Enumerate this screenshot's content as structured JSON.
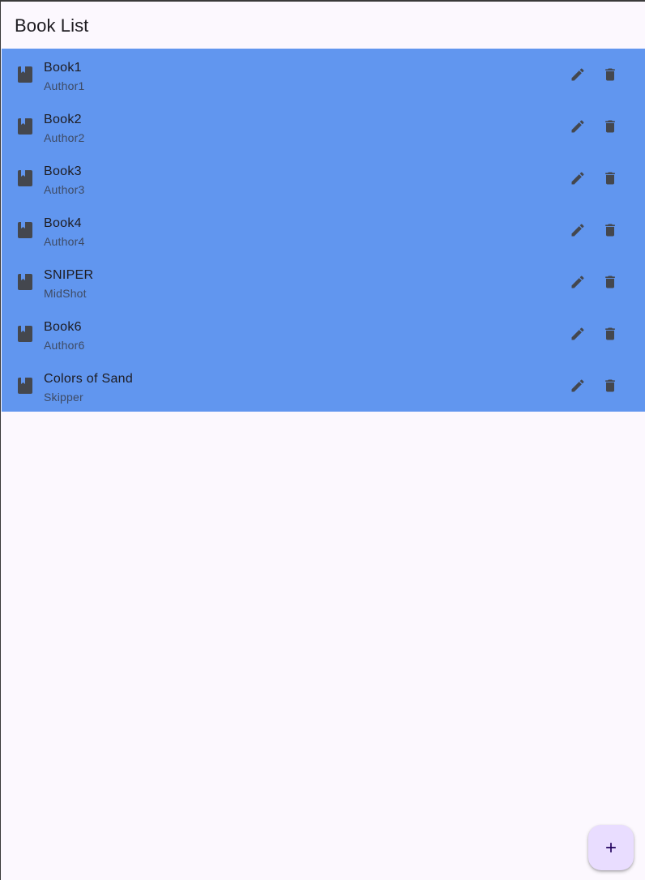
{
  "appbar": {
    "title": "Book List"
  },
  "colors": {
    "list_background": "#6196ef",
    "page_background": "#fcf8fe",
    "icon": "#44474e",
    "fab_background": "#e9ddff",
    "fab_icon": "#21005d"
  },
  "books": [
    {
      "title": "Book1",
      "author": "Author1",
      "icon": "book-icon"
    },
    {
      "title": "Book2",
      "author": "Author2",
      "icon": "book-icon"
    },
    {
      "title": "Book3",
      "author": "Author3",
      "icon": "book-icon"
    },
    {
      "title": "Book4",
      "author": "Author4",
      "icon": "book-icon"
    },
    {
      "title": "SNIPER",
      "author": "MidShot",
      "icon": "book-icon"
    },
    {
      "title": "Book6",
      "author": "Author6",
      "icon": "book-icon"
    },
    {
      "title": "Colors of Sand",
      "author": "Skipper",
      "icon": "book-icon"
    }
  ],
  "row_actions": {
    "edit_icon": "edit-icon",
    "delete_icon": "delete-icon"
  },
  "fab": {
    "icon": "add-icon"
  }
}
